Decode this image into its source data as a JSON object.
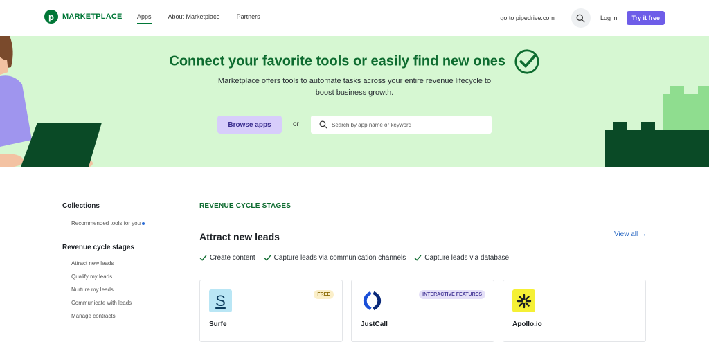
{
  "header": {
    "logo_text": "MARKETPLACE",
    "logo_letter": "p",
    "nav": [
      {
        "label": "Apps",
        "active": true
      },
      {
        "label": "About Marketplace",
        "active": false
      },
      {
        "label": "Partners",
        "active": false
      }
    ],
    "goto_link": "go to pipedrive.com",
    "login": "Log in",
    "try_free": "Try it free"
  },
  "hero": {
    "title": "Connect your favorite tools or easily find new ones",
    "subtitle": "Marketplace offers tools to automate tasks across your entire revenue lifecycle to boost business growth.",
    "browse_button": "Browse apps",
    "or_text": "or",
    "search_placeholder": "Search by app name or keyword"
  },
  "sidebar": {
    "collections_heading": "Collections",
    "collections_items": [
      {
        "label": "Recommended tools for you"
      }
    ],
    "stages_heading": "Revenue cycle stages",
    "stages_items": [
      {
        "label": "Attract new leads"
      },
      {
        "label": "Qualify my leads"
      },
      {
        "label": "Nurture my leads"
      },
      {
        "label": "Communicate with leads"
      },
      {
        "label": "Manage contracts"
      }
    ]
  },
  "main": {
    "stages_heading": "REVENUE CYCLE STAGES",
    "category_title": "Attract new leads",
    "view_all": "View all →",
    "tags": [
      "Create content",
      "Capture leads via communication channels",
      "Capture leads via database"
    ],
    "cards": [
      {
        "name": "Surfe",
        "badge": "FREE",
        "logo_letter": "S",
        "logo_bg": "#b9e6f5",
        "logo_color": "#0b3c5d"
      },
      {
        "name": "JustCall",
        "badge": "INTERACTIVE FEATURES",
        "logo_bg": "#ffffff",
        "logo_color": "#1a4fd8"
      },
      {
        "name": "Apollo.io",
        "badge": "",
        "logo_bg": "#f5f035",
        "logo_color": "#1b1f24"
      }
    ]
  },
  "colors": {
    "brand_green": "#017737",
    "hero_bg": "#d6f7d2",
    "accent_purple": "#6e5de8",
    "link_blue": "#2b6ac4"
  }
}
